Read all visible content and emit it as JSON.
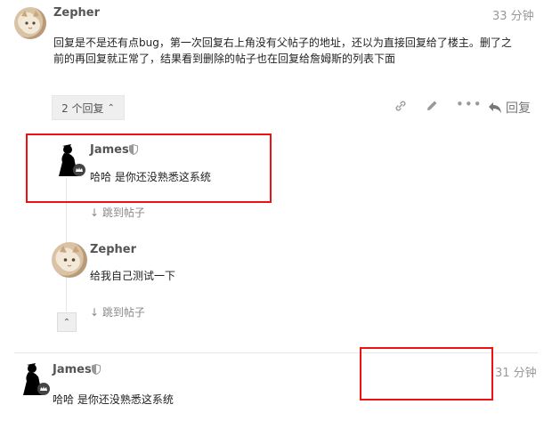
{
  "post": {
    "author": "Zepher",
    "time": "33 分钟",
    "body_line1": "回复是不是还有点bug，第一次回复右上角没有父帖子的地址，还以为直接回复给了楼主。删了之",
    "body_line2": "前的再回复就正常了，结果看到删除的帖子也在回复给詹姆斯的列表下面",
    "replies_label": "2 个回复",
    "reply_label": "回复"
  },
  "replies": [
    {
      "author": "James",
      "text": "哈哈 是你还没熟悉这系统",
      "jump": "跳到帖子"
    },
    {
      "author": "Zepher",
      "text": "给我自己测试一下",
      "jump": "跳到帖子"
    }
  ],
  "post2": {
    "author": "James",
    "time": "31 分钟",
    "text": "哈哈 是你还没熟悉这系统"
  },
  "icons": {
    "link": "link-icon",
    "edit": "pencil-icon",
    "more": "more-icon",
    "reply": "reply-arrow-icon",
    "shield": "shield-icon",
    "down": "arrow-down-icon",
    "up": "chevron-up-icon"
  },
  "colors": {
    "highlight": "#ee1111",
    "meta": "#999999"
  }
}
